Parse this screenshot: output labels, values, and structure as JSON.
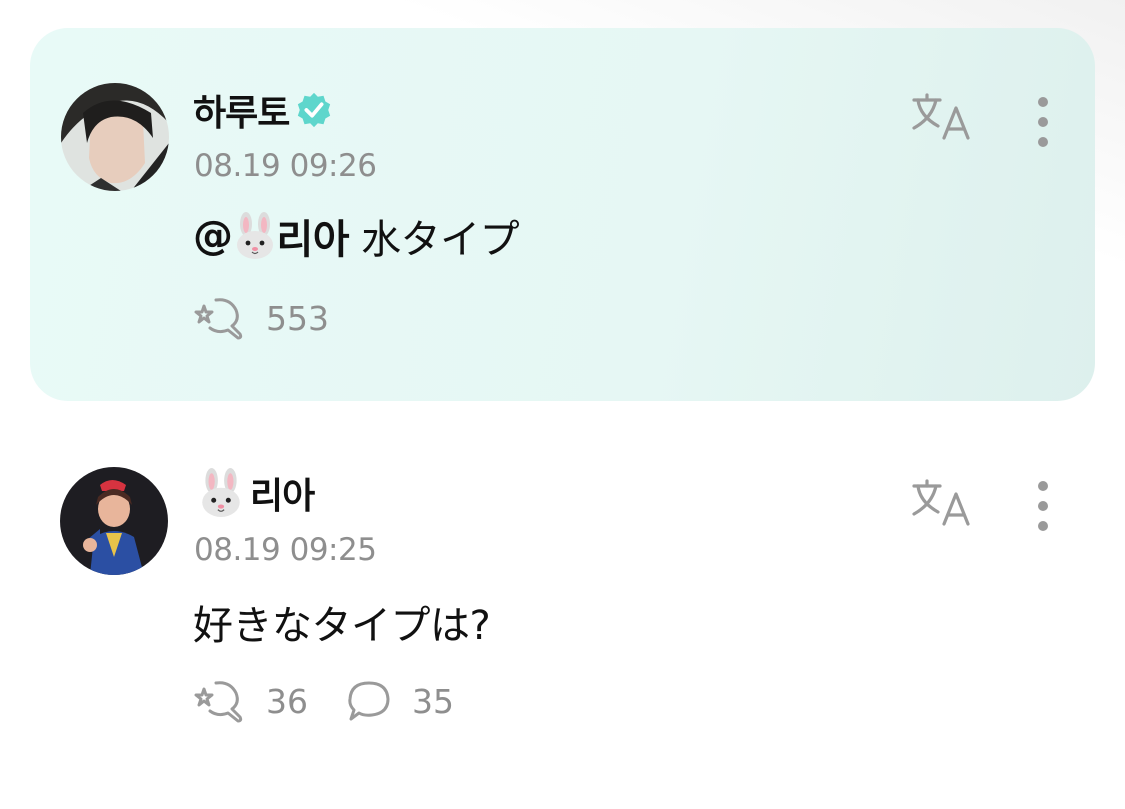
{
  "posts": [
    {
      "author": "하루토",
      "verified": true,
      "timestamp": "08.19 09:26",
      "mention": "@",
      "mention_name": "리아",
      "text": "水タイプ",
      "likes": "553",
      "highlighted": true
    },
    {
      "author": "리아",
      "timestamp": "08.19 09:25",
      "text": "好きなタイプは?",
      "likes": "36",
      "comments": "35",
      "highlighted": false
    }
  ],
  "icons": {
    "verified": "verified-badge-icon",
    "translate": "translate-icon",
    "more": "more-vertical-icon",
    "like": "like-icon",
    "comment": "comment-icon",
    "author_emoji": "rabbit-face-emoji"
  },
  "colors": {
    "highlight_bg": "#e8faf7",
    "verified": "#5ed6cc",
    "muted_text": "#8e8e8e",
    "icon_gray": "#9a9a9a"
  }
}
